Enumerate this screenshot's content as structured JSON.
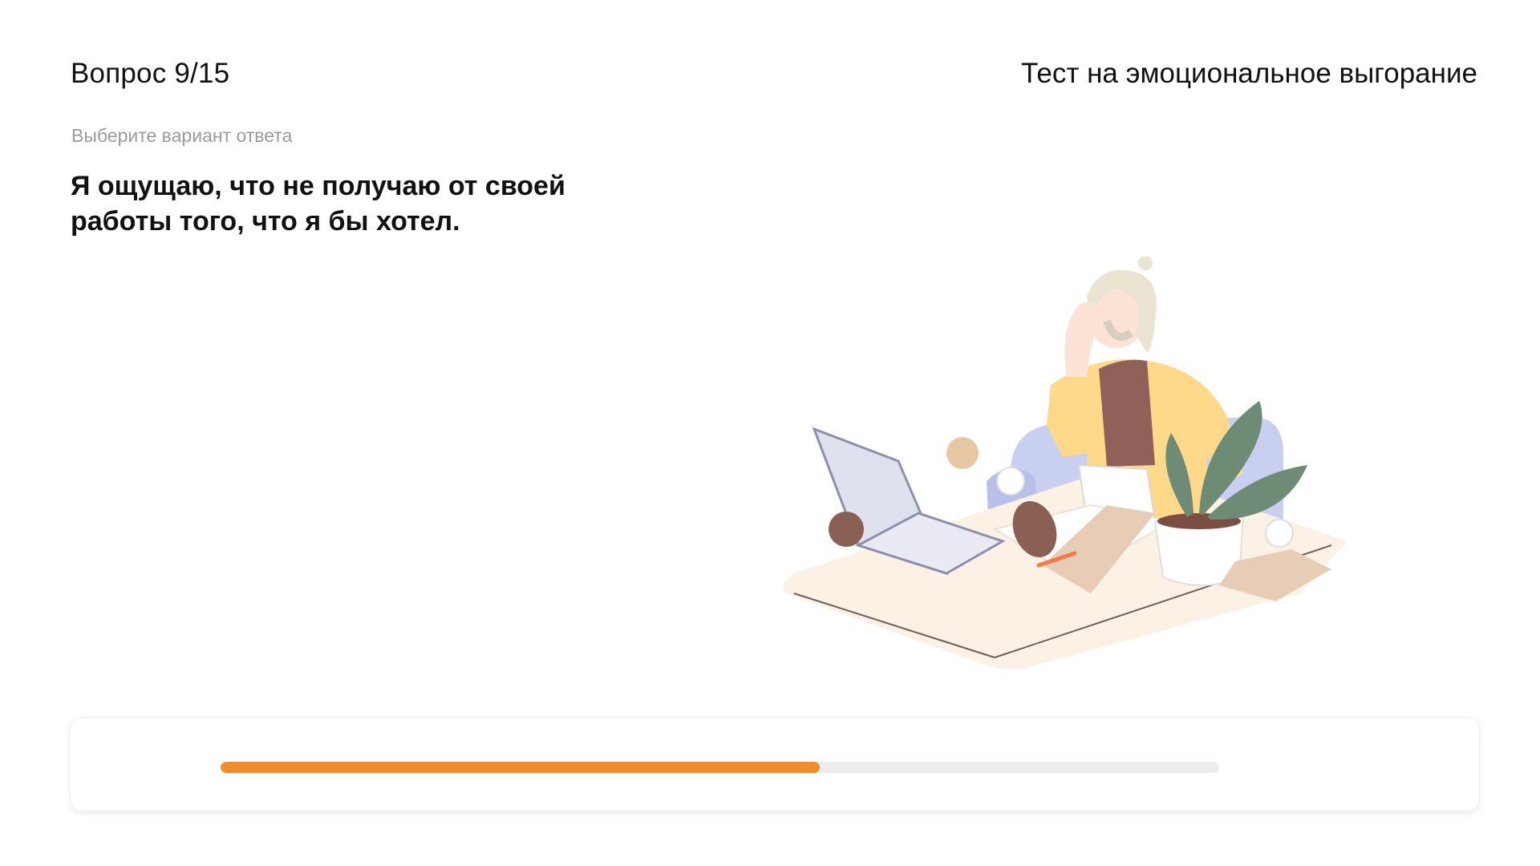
{
  "header": {
    "question_counter": "Вопрос 9/15",
    "test_title": "Тест на эмоциональное выгорание"
  },
  "question": {
    "hint": "Выберите вариант ответа",
    "text_line1": "Я ощущаю, что не получаю от своей",
    "text_line2": "работы того, что я бы хотел."
  },
  "illustration": {
    "icon": "stressed-office-worker-illustration"
  },
  "progress": {
    "current": 9,
    "total": 15,
    "fraction": 0.6,
    "fill_color": "#F28C28",
    "track_color": "#EDEDED"
  }
}
